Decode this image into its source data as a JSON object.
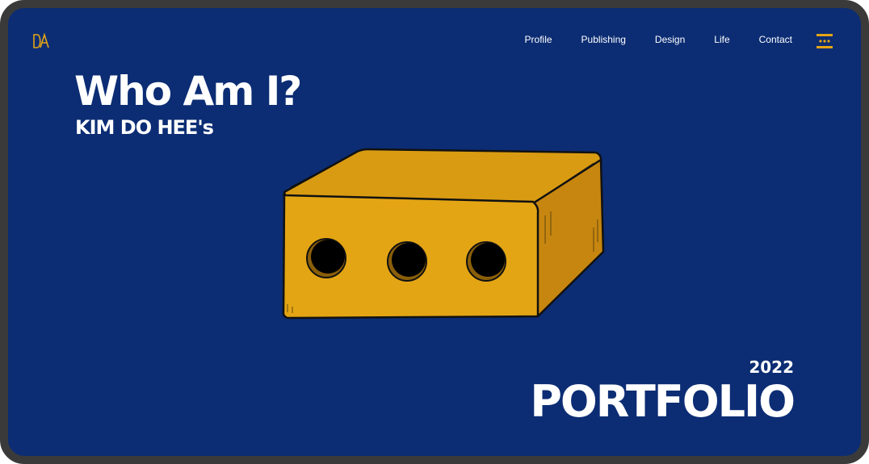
{
  "brand": {
    "logo_icon": "da-monogram-icon",
    "accent_color": "#e3a514"
  },
  "nav": {
    "items": [
      {
        "label": "Profile"
      },
      {
        "label": "Publishing"
      },
      {
        "label": "Design"
      },
      {
        "label": "Life"
      },
      {
        "label": "Contact"
      }
    ],
    "menu_icon": "hamburger-menu-icon"
  },
  "hero": {
    "headline": "Who Am I?",
    "subhead": "KIM DO HEE's",
    "illustration": "brick-icon",
    "year": "2022",
    "title": "PORTFOLIO"
  },
  "colors": {
    "background": "#0c2d74",
    "frame": "#3a3a3a",
    "text": "#ffffff",
    "brick_front": "#e3a514",
    "brick_top": "#d99b12",
    "brick_side": "#c7860f"
  }
}
